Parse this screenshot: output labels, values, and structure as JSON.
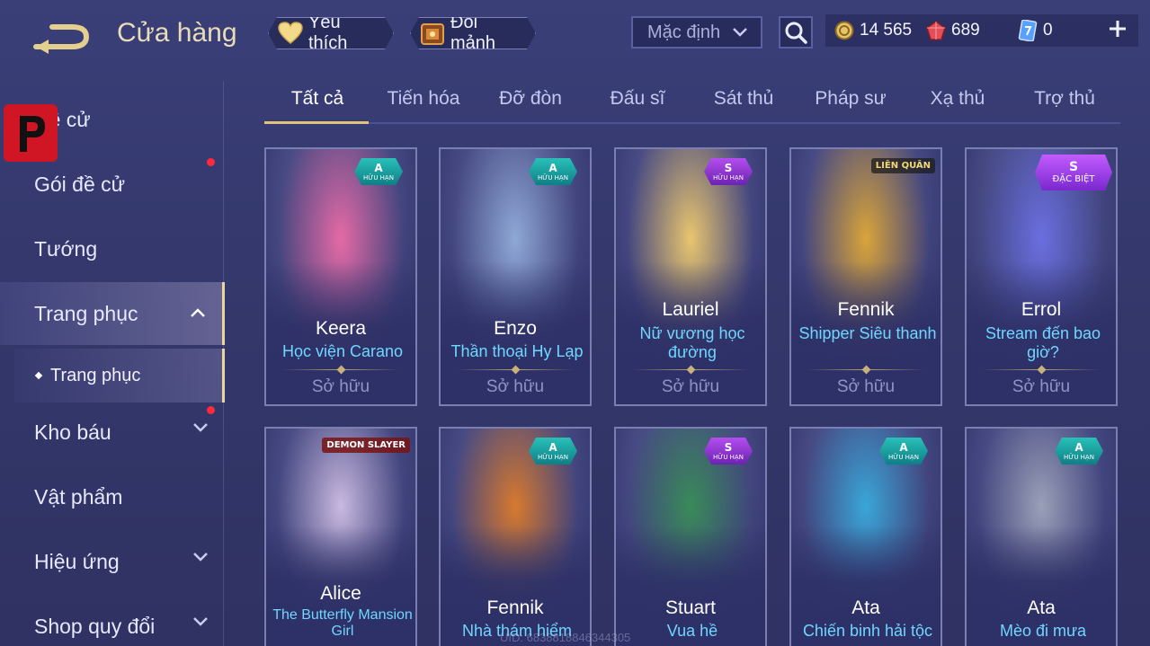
{
  "header": {
    "title": "Cửa hàng",
    "favorites_label": "Yêu thích",
    "exchange_fragments_label": "Đổi mảnh",
    "sort_value": "Mặc định"
  },
  "currency": {
    "gold": "14 565",
    "ruby": "689",
    "voucher": "0"
  },
  "sidebar": {
    "items": [
      {
        "label": "Đề cử"
      },
      {
        "label": "Gói đề cử"
      },
      {
        "label": "Tướng"
      },
      {
        "label": "Trang phục"
      },
      {
        "label": "Kho báu"
      },
      {
        "label": "Vật phẩm"
      },
      {
        "label": "Hiệu ứng"
      },
      {
        "label": "Shop quy đổi"
      }
    ],
    "subitem": "Trang phục"
  },
  "tabs": [
    "Tất cả",
    "Tiến hóa",
    "Đỡ đòn",
    "Đấu sĩ",
    "Sát thủ",
    "Pháp sư",
    "Xạ thủ",
    "Trợ thủ"
  ],
  "cards": [
    {
      "hero": "Keera",
      "skin": "Học viện Carano",
      "owned": "Sở hữu",
      "tier": "A",
      "limited": "HỮU HẠN",
      "color": "#e46aa6"
    },
    {
      "hero": "Enzo",
      "skin": "Thần thoại Hy Lạp",
      "owned": "Sở hữu",
      "tier": "A",
      "limited": "HỮU HẠN",
      "color": "#8fa8d6"
    },
    {
      "hero": "Lauriel",
      "skin": "Nữ vương học đường",
      "owned": "Sở hữu",
      "tier": "S",
      "limited": "HỮU HẠN",
      "color": "#e8c56e"
    },
    {
      "hero": "Fennik",
      "skin": "Shipper Siêu thanh",
      "owned": "Sở hữu",
      "brand": "LIÊN QUÂN",
      "color": "#d9a43a"
    },
    {
      "hero": "Errol",
      "skin": "Stream đến bao giờ?",
      "owned": "Sở hữu",
      "tier": "S",
      "limited": "ĐẶC BIỆT",
      "color": "#6a6fe0"
    },
    {
      "hero": "Alice",
      "skin": "The Butterfly Mansion Girl",
      "brand": "DEMON SLAYER",
      "color": "#c9b9e0"
    },
    {
      "hero": "Fennik",
      "skin": "Nhà thám hiểm",
      "tier": "A",
      "limited": "HỮU HẠN",
      "color": "#d7792e"
    },
    {
      "hero": "Stuart",
      "skin": "Vua hề",
      "tier": "S",
      "limited": "HỮU HẠN",
      "color": "#3a8a5a"
    },
    {
      "hero": "Ata",
      "skin": "Chiến binh hải tộc",
      "tier": "A",
      "limited": "HỮU HẠN",
      "color": "#3aa6d8"
    },
    {
      "hero": "Ata",
      "skin": "Mèo đi mưa",
      "tier": "A",
      "limited": "HỮU HẠN",
      "color": "#9aa0b8"
    }
  ],
  "uid": "UID: 6838818846344305",
  "colors": {
    "accent_gold": "#e3c27a",
    "skin_name": "#6fd6ff",
    "notification_red": "#ff2a3a"
  }
}
